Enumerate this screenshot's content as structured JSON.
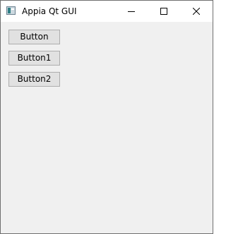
{
  "window": {
    "title": "Appia Qt GUI",
    "icons": {
      "app": "app-icon",
      "minimize": "minimize-icon",
      "maximize": "maximize-icon",
      "close": "close-icon"
    }
  },
  "buttons": [
    {
      "label": "Button"
    },
    {
      "label": "Button1"
    },
    {
      "label": "Button2"
    }
  ],
  "colors": {
    "titlebar": "#ffffff",
    "client_area": "#f0f0f0",
    "button_face": "#e1e1e1",
    "button_border": "#adadad",
    "window_border": "#6f6f6f"
  }
}
